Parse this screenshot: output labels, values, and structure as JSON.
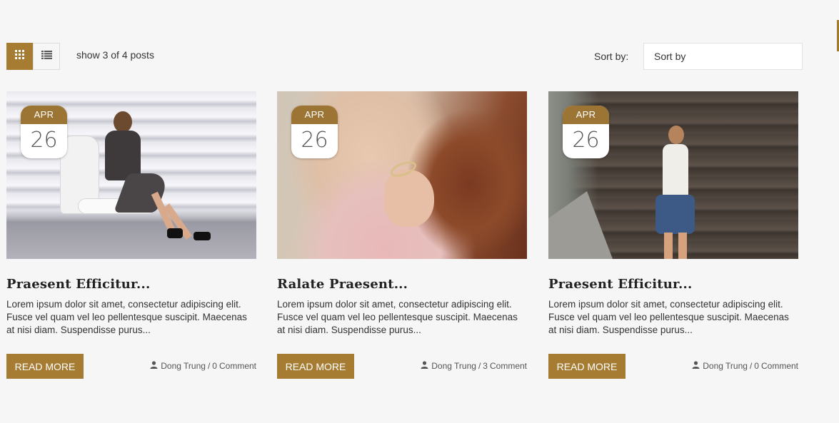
{
  "toolbar": {
    "grid_view_icon": "grid-icon",
    "list_view_icon": "list-icon",
    "posts_count": "show 3 of 4 posts",
    "sort_label": "Sort by:",
    "sort_value": "Sort by"
  },
  "colors": {
    "accent": "#a67c33",
    "badge_month_bg": "#9c7534",
    "page_bg": "#f6f6f6"
  },
  "posts": [
    {
      "month": "APR",
      "day": "26",
      "title": "Praesent Efficitur...",
      "excerpt": "Lorem ipsum dolor sit amet, consectetur adipiscing elit. Fusce vel quam vel leo pellentesque suscipit. Maecenas at nisi diam. Suspendisse purus...",
      "read_more": "READ MORE",
      "author": "Dong Trung",
      "separator": "/",
      "comment_count": "0",
      "comment_label": "Comment"
    },
    {
      "month": "APR",
      "day": "26",
      "title": "Ralate Praesent...",
      "excerpt": "Lorem ipsum dolor sit amet, consectetur adipiscing elit. Fusce vel quam vel leo pellentesque suscipit. Maecenas at nisi diam. Suspendisse purus...",
      "read_more": "READ MORE",
      "author": "Dong Trung",
      "separator": "/",
      "comment_count": "3",
      "comment_label": "Comment"
    },
    {
      "month": "APR",
      "day": "26",
      "title": "Praesent Efficitur...",
      "excerpt": "Lorem ipsum dolor sit amet, consectetur adipiscing elit. Fusce vel quam vel leo pellentesque suscipit. Maecenas at nisi diam. Suspendisse purus...",
      "read_more": "READ MORE",
      "author": "Dong Trung",
      "separator": "/",
      "comment_count": "0",
      "comment_label": "Comment"
    }
  ]
}
